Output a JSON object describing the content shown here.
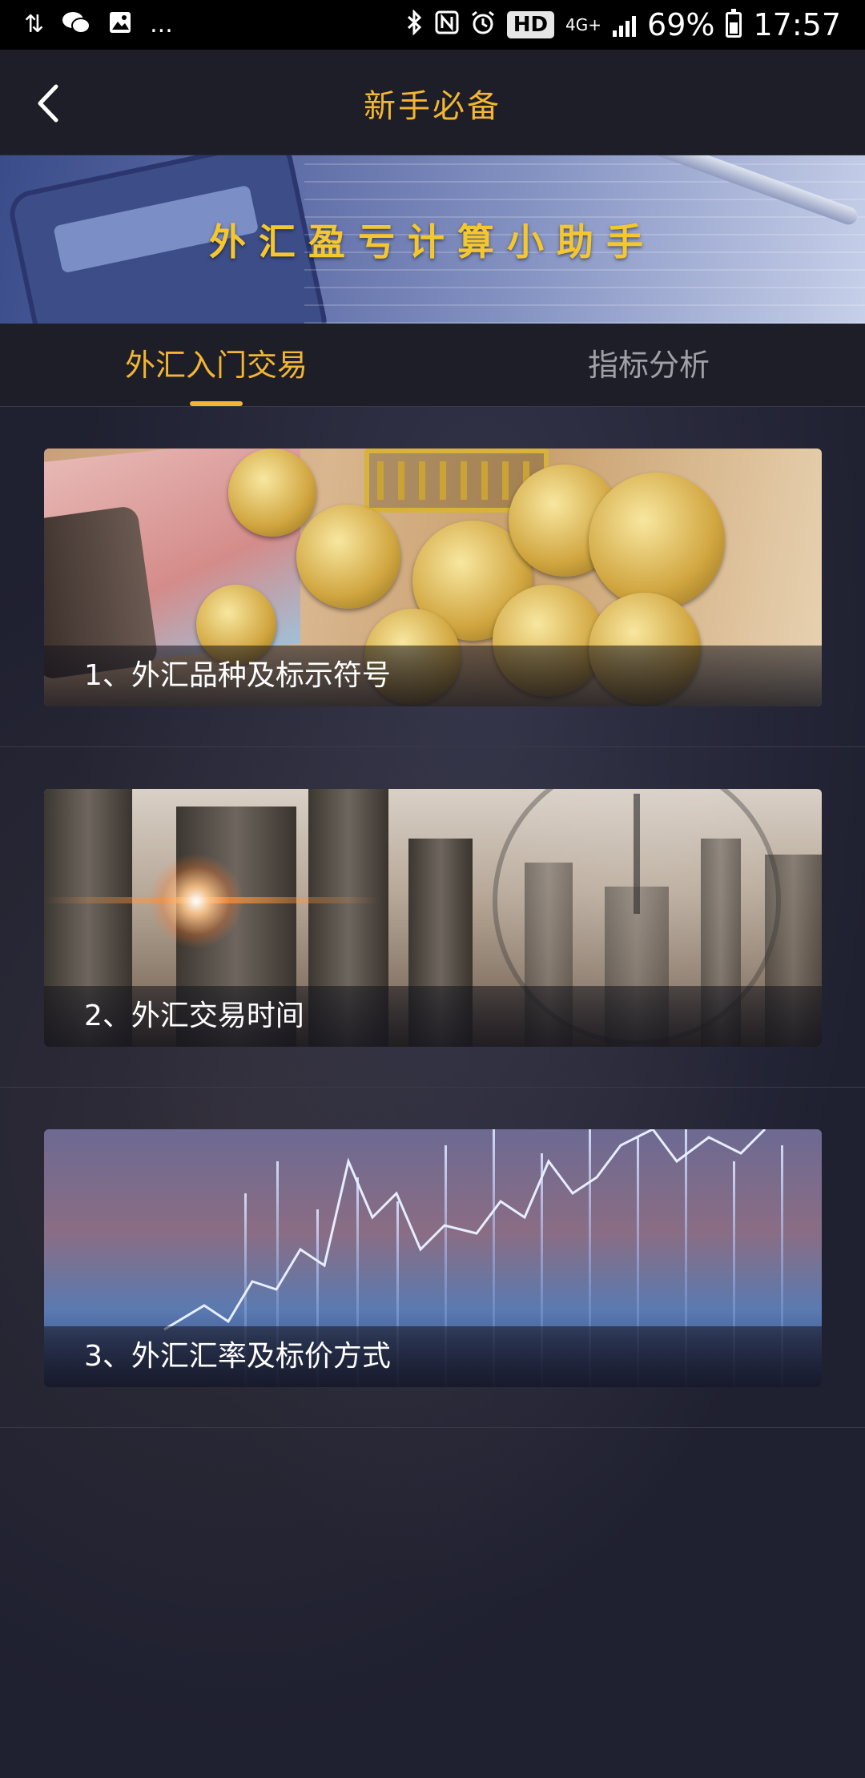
{
  "status_bar": {
    "left_icons": [
      "usb-debug-icon",
      "wechat-icon",
      "gallery-icon",
      "more-dots-icon"
    ],
    "more_text": "...",
    "right_icons": [
      "bluetooth-icon",
      "nfc-icon",
      "alarm-icon"
    ],
    "hd_label": "HD",
    "network_label": "4G+",
    "battery_percent": "69%",
    "time": "17:57"
  },
  "header": {
    "back_icon": "chevron-left-icon",
    "title": "新手必备"
  },
  "banner": {
    "title": "外汇盈亏计算小助手"
  },
  "tabs": [
    {
      "label": "外汇入门交易",
      "active": true
    },
    {
      "label": "指标分析",
      "active": false
    }
  ],
  "articles": [
    {
      "caption": "1、外汇品种及标示符号",
      "image": "coins-and-currency-photo"
    },
    {
      "caption": "2、外汇交易时间",
      "image": "city-clock-photo"
    },
    {
      "caption": "3、外汇汇率及标价方式",
      "image": "stock-chart-photo"
    }
  ],
  "colors": {
    "accent": "#f3b632",
    "background": "#1e1e28",
    "tab_inactive": "#a0a0a8"
  }
}
